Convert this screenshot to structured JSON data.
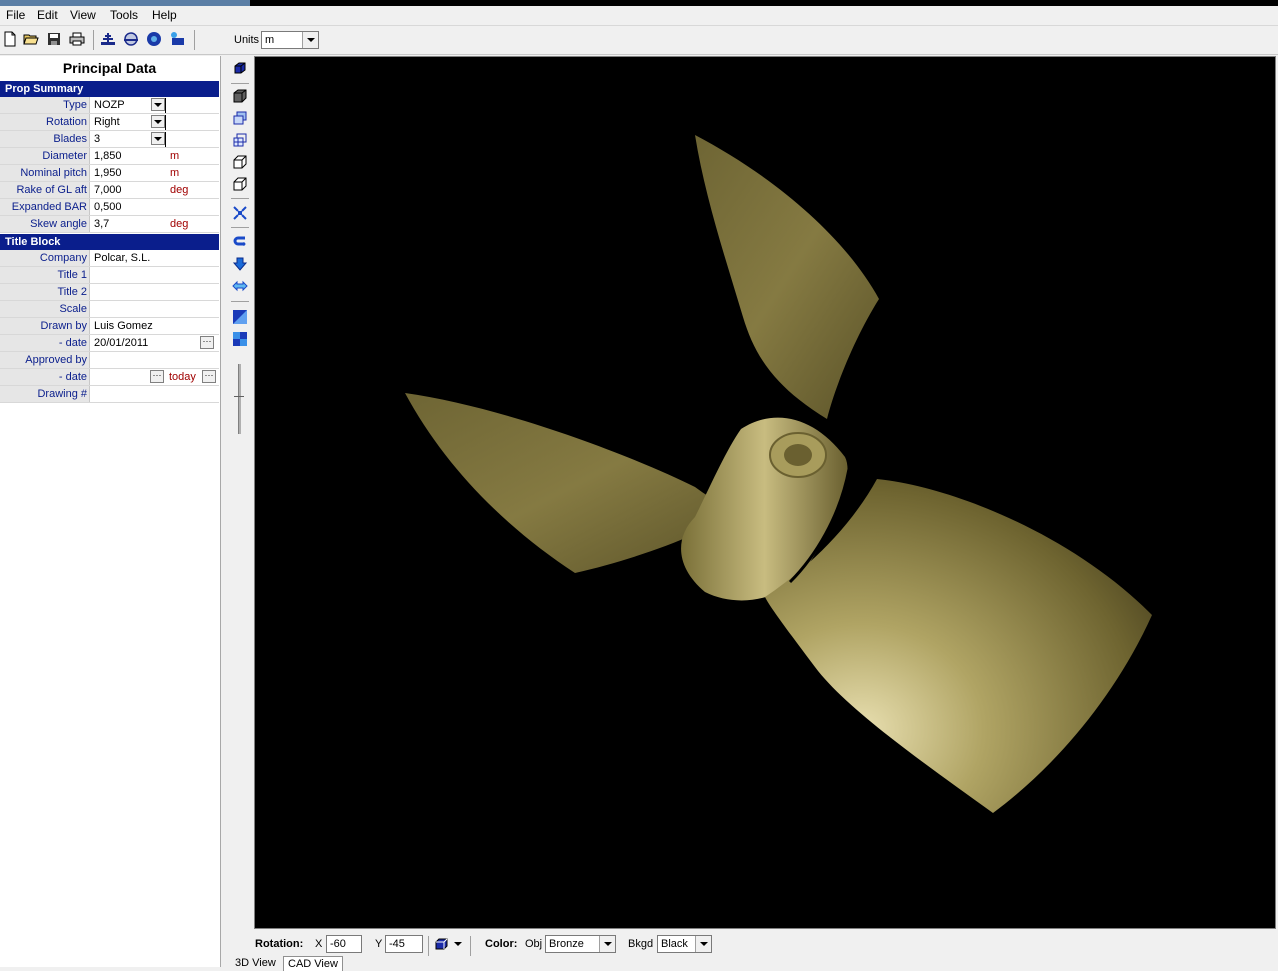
{
  "menu": [
    "File",
    "Edit",
    "View",
    "Tools",
    "Help"
  ],
  "toolbar": {
    "units_label": "Units",
    "units_value": "m",
    "icons": [
      "new-file-icon",
      "open-folder-icon",
      "save-icon",
      "print-icon",
      "prop-dims-icon",
      "blade-section-icon",
      "propeller-3d-icon",
      "export-icon"
    ]
  },
  "panel": {
    "title": "Principal Data",
    "prop_summary": {
      "header": "Prop Summary",
      "type": {
        "label": "Type",
        "value": "NOZP"
      },
      "rotation": {
        "label": "Rotation",
        "value": "Right"
      },
      "blades": {
        "label": "Blades",
        "value": "3"
      },
      "diameter": {
        "label": "Diameter",
        "value": "1,850",
        "unit": "m"
      },
      "nominal_pitch": {
        "label": "Nominal pitch",
        "value": "1,950",
        "unit": "m"
      },
      "rake": {
        "label": "Rake of GL aft",
        "value": "7,000",
        "unit": "deg"
      },
      "bar": {
        "label": "Expanded BAR",
        "value": "0,500"
      },
      "skew": {
        "label": "Skew angle",
        "value": "3,7",
        "unit": "deg"
      }
    },
    "title_block": {
      "header": "Title Block",
      "company": {
        "label": "Company",
        "value": "Polcar, S.L."
      },
      "title1": {
        "label": "Title 1",
        "value": ""
      },
      "title2": {
        "label": "Title 2",
        "value": ""
      },
      "scale": {
        "label": "Scale",
        "value": ""
      },
      "drawn_by": {
        "label": "Drawn by",
        "value": "Luis Gomez"
      },
      "drawn_date": {
        "label": "- date",
        "value": "20/01/2011"
      },
      "approved_by": {
        "label": "Approved by",
        "value": ""
      },
      "approved_date": {
        "label": "- date",
        "value": "",
        "today": "today"
      },
      "drawing_no": {
        "label": "Drawing #",
        "value": ""
      }
    }
  },
  "bottom": {
    "rotation_label": "Rotation:",
    "x_label": "X",
    "x_value": "-60",
    "y_label": "Y",
    "y_value": "-45",
    "color_label": "Color:",
    "obj_label": "Obj",
    "obj_value": "Bronze",
    "bkgd_label": "Bkgd",
    "bkgd_value": "Black"
  },
  "tabs": [
    "3D View",
    "CAD View"
  ],
  "colors": {
    "accent": "#0a1e8c",
    "unit": "#a00000",
    "bronze_light": "#e8dfb0",
    "bronze_mid": "#8a7f45",
    "bronze_dark": "#4a4220"
  }
}
